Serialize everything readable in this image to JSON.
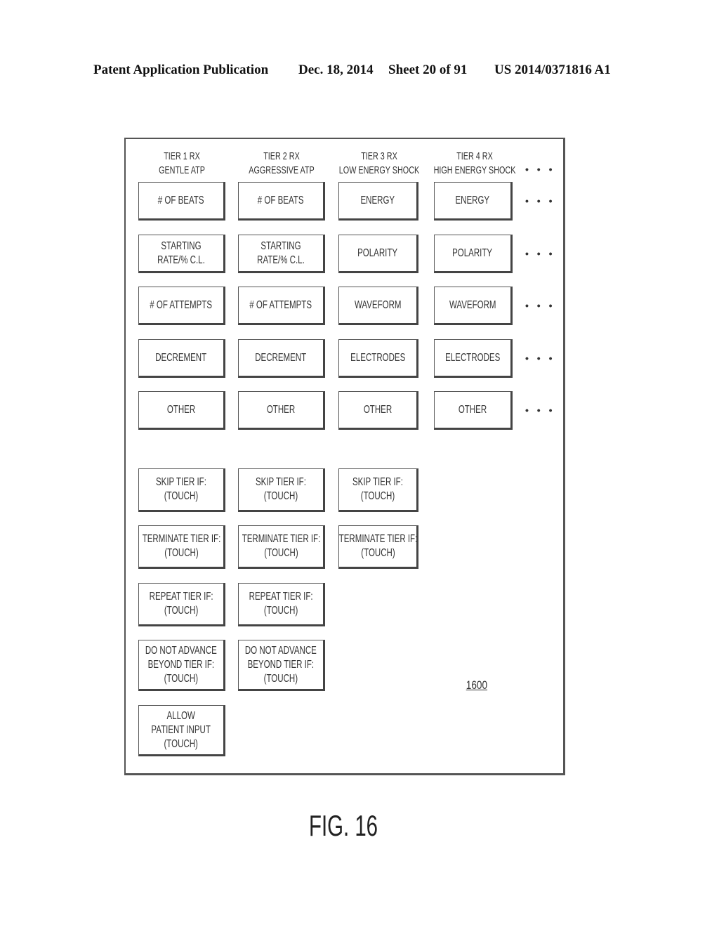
{
  "header": {
    "publication": "Patent Application Publication",
    "date": "Dec. 18, 2014",
    "sheet": "Sheet 20 of 91",
    "number": "US 2014/0371816 A1"
  },
  "columns": [
    {
      "line1": "TIER 1 RX",
      "line2": "GENTLE ATP"
    },
    {
      "line1": "TIER 2 RX",
      "line2": "AGGRESSIVE ATP"
    },
    {
      "line1": "TIER 3 RX",
      "line2": "LOW ENERGY SHOCK"
    },
    {
      "line1": "TIER 4 RX",
      "line2": "HIGH ENERGY SHOCK"
    }
  ],
  "ellipsis": "• • •",
  "parameter_rows": [
    [
      "# OF BEATS",
      "# OF BEATS",
      "ENERGY",
      "ENERGY"
    ],
    [
      [
        "STARTING",
        "RATE/% C.L."
      ],
      [
        "STARTING",
        "RATE/% C.L."
      ],
      "POLARITY",
      "POLARITY"
    ],
    [
      "# OF ATTEMPTS",
      "# OF ATTEMPTS",
      "WAVEFORM",
      "WAVEFORM"
    ],
    [
      "DECREMENT",
      "DECREMENT",
      "ELECTRODES",
      "ELECTRODES"
    ],
    [
      "OTHER",
      "OTHER",
      "OTHER",
      "OTHER"
    ]
  ],
  "condition_rows": [
    {
      "lines": [
        "SKIP TIER IF:",
        "(TOUCH)"
      ],
      "count": 3
    },
    {
      "lines": [
        "TERMINATE TIER IF:",
        "(TOUCH)"
      ],
      "count": 3
    },
    {
      "lines": [
        "REPEAT TIER IF:",
        "(TOUCH)"
      ],
      "count": 2
    },
    {
      "lines": [
        "DO NOT ADVANCE",
        "BEYOND TIER IF:",
        "(TOUCH)"
      ],
      "count": 2
    },
    {
      "lines": [
        "ALLOW",
        "PATIENT INPUT",
        "(TOUCH)"
      ],
      "count": 1
    }
  ],
  "reference_numeral": "1600",
  "figure_label": "FIG. 16"
}
